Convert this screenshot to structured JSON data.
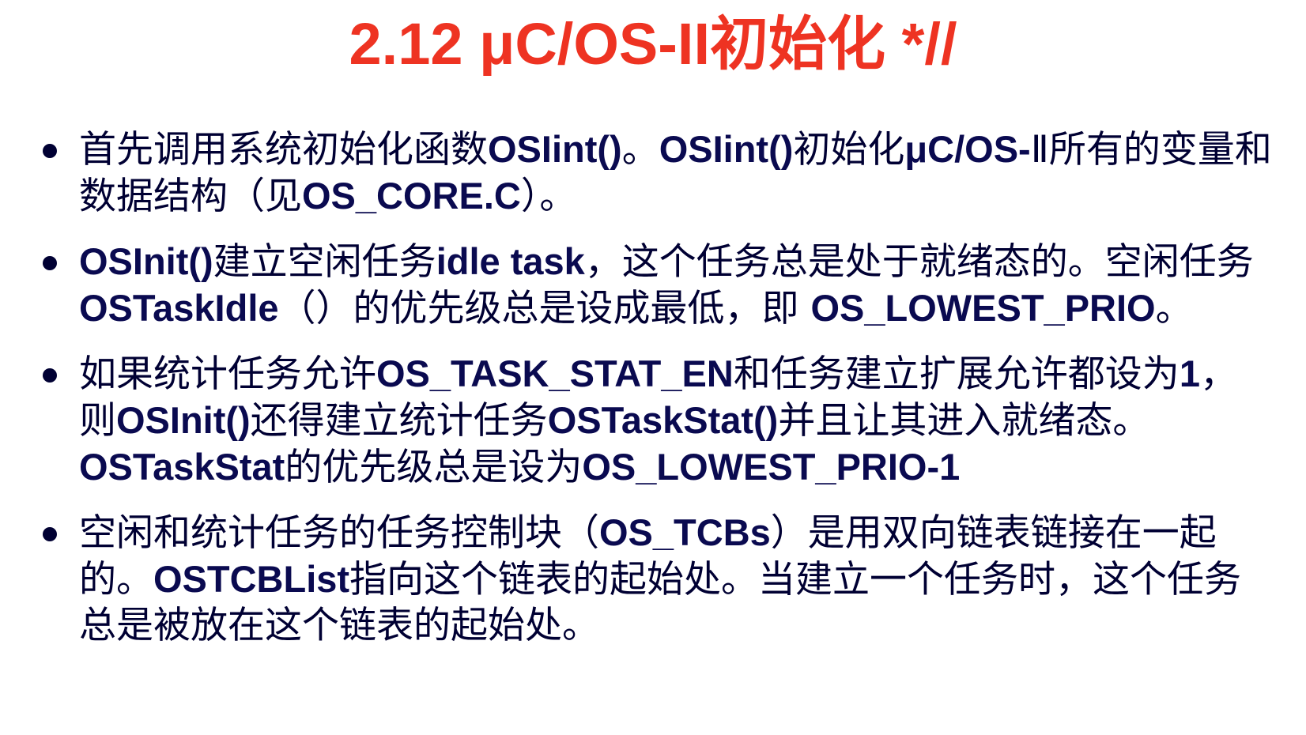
{
  "title": "2.12 μC/OS-II初始化  *//",
  "colors": {
    "title": "#ee3322",
    "body": "#000033",
    "bold": "#0a0a50"
  },
  "bullets": [
    {
      "segments": [
        {
          "text": "首先调用系统初始化函数",
          "bold": false
        },
        {
          "text": "OSIint()",
          "bold": true
        },
        {
          "text": "。",
          "bold": false
        },
        {
          "text": "OSIint()",
          "bold": true
        },
        {
          "text": "初始化",
          "bold": false
        },
        {
          "text": "μC/OS-",
          "bold": true
        },
        {
          "text": "Ⅱ所有的变量和数据结构（见",
          "bold": false
        },
        {
          "text": "OS_CORE.C",
          "bold": true
        },
        {
          "text": "）。",
          "bold": false
        }
      ]
    },
    {
      "segments": [
        {
          "text": "OSInit()",
          "bold": true
        },
        {
          "text": "建立空闲任务",
          "bold": false
        },
        {
          "text": "idle task",
          "bold": true
        },
        {
          "text": "，这个任务总是处于就绪态的。空闲任务",
          "bold": false
        },
        {
          "text": "OSTaskIdle",
          "bold": true
        },
        {
          "text": "（）的优先级总是设成最低，即 ",
          "bold": false
        },
        {
          "text": "OS_LOWEST_PRIO",
          "bold": true
        },
        {
          "text": "。",
          "bold": false
        }
      ]
    },
    {
      "segments": [
        {
          "text": "如果统计任务允许",
          "bold": false
        },
        {
          "text": "OS_TASK_STAT_EN",
          "bold": true
        },
        {
          "text": "和任务建立扩展允许都设为",
          "bold": false
        },
        {
          "text": "1",
          "bold": true
        },
        {
          "text": "，则",
          "bold": false
        },
        {
          "text": "OSInit()",
          "bold": true
        },
        {
          "text": "还得建立统计任务",
          "bold": false
        },
        {
          "text": "OSTaskStat()",
          "bold": true
        },
        {
          "text": "并且让其进入就绪态。",
          "bold": false
        },
        {
          "text": "OSTaskStat",
          "bold": true
        },
        {
          "text": "的优先级总是设为",
          "bold": false
        },
        {
          "text": "OS_LOWEST_PRIO-1",
          "bold": true
        }
      ]
    },
    {
      "segments": [
        {
          "text": "空闲和统计任务的任务控制块（",
          "bold": false
        },
        {
          "text": "OS_TCBs",
          "bold": true
        },
        {
          "text": "）是用双向链表链接在一起的。",
          "bold": false
        },
        {
          "text": "OSTCBList",
          "bold": true
        },
        {
          "text": "指向这个链表的起始处。当建立一个任务时，这个任务总是被放在这个链表的起始处。",
          "bold": false
        }
      ]
    }
  ]
}
